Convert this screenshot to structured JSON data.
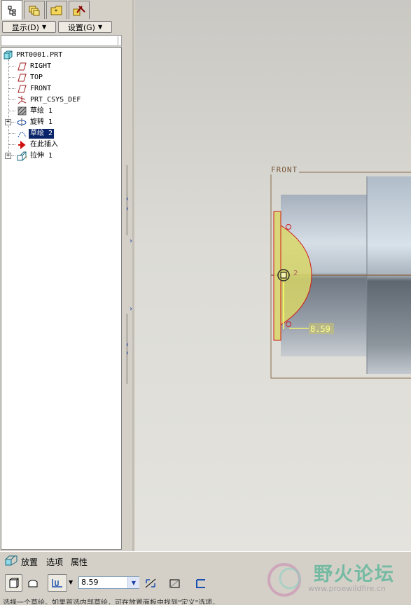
{
  "left_panel": {
    "tabs": [
      {
        "icon": "model-tree-icon"
      },
      {
        "icon": "layers-icon"
      },
      {
        "icon": "folder-icon"
      },
      {
        "icon": "favorites-tools-icon"
      }
    ],
    "show_label": "显示(D)",
    "settings_label": "设置(G)"
  },
  "model_tree": {
    "items": [
      {
        "label": "PRT0001.PRT",
        "icon": "part-icon"
      },
      {
        "label": "RIGHT",
        "icon": "datum-plane-icon"
      },
      {
        "label": "TOP",
        "icon": "datum-plane-icon"
      },
      {
        "label": "FRONT",
        "icon": "datum-plane-icon"
      },
      {
        "label": "PRT_CSYS_DEF",
        "icon": "csys-icon"
      },
      {
        "label": "草绘 1",
        "icon": "sketch-icon"
      },
      {
        "label": "旋转 1",
        "icon": "revolve-icon",
        "expandable": true
      },
      {
        "label": "草绘 2",
        "icon": "sketch-icon",
        "selected": true
      },
      {
        "label": "在此插入",
        "icon": "insert-here-arrow-icon"
      },
      {
        "label": "拉伸 1",
        "icon": "extrude-icon",
        "expandable": true
      }
    ]
  },
  "graphics": {
    "datum_label": "FRONT",
    "dimension_value": "8.59",
    "small_label": "2"
  },
  "dashboard": {
    "tabs": [
      "放置",
      "选项",
      "属性"
    ],
    "depth_value": "8.59",
    "status_text": "选择一个草绘。如果首选内部草绘，可在放置面板中找到\"定义\"选项。",
    "watermark_title": "野火论坛",
    "watermark_url": "www.proewildfire.cn"
  },
  "colors": {
    "selection": "#0a246a",
    "sketch_fill": "#d8d66a",
    "sketch_edge": "#d01818",
    "datum_frame": "#8a6a4a"
  }
}
